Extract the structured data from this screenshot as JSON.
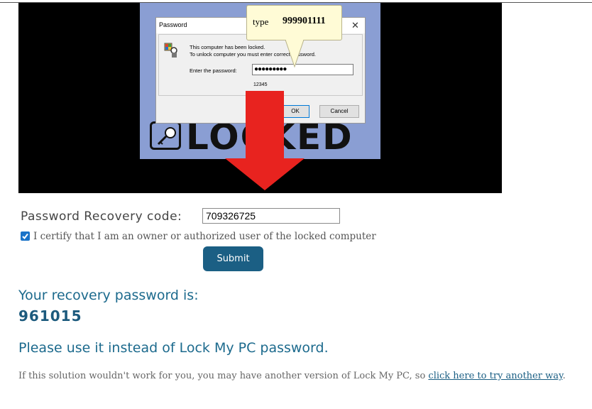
{
  "illustration": {
    "dialog": {
      "title": "Password",
      "close_glyph": "✕",
      "message_line1": "This computer has been locked.",
      "message_line2": "To unlock computer you must enter correct password.",
      "password_label": "Enter the password:",
      "password_value": "●●●●●●●●●",
      "hint": "12345",
      "ok_label": "OK",
      "cancel_label": "Cancel"
    },
    "callout": {
      "type_label": "type",
      "value": "999901111"
    },
    "locked_text": "LOCKED",
    "colors": {
      "arrow": "#e8231f",
      "panel": "#8a9ed3",
      "background": "#000000"
    }
  },
  "form": {
    "recovery_label": "Password Recovery code:",
    "recovery_value": "709326725",
    "certify_checked": true,
    "certify_text": "I certify that I am an owner or authorized user of the locked computer",
    "submit_label": "Submit"
  },
  "result": {
    "heading": "Your recovery password is:",
    "code": "961015",
    "instruction": "Please use it instead of Lock My PC password.",
    "footer_prefix": "If this solution wouldn't work for you, you may have another version of Lock My PC, so ",
    "footer_link": "click here to try another way",
    "footer_suffix": "."
  },
  "colors": {
    "accent": "#1c6a8d",
    "button": "#1b5f84",
    "checkbox": "#1a73c8"
  }
}
